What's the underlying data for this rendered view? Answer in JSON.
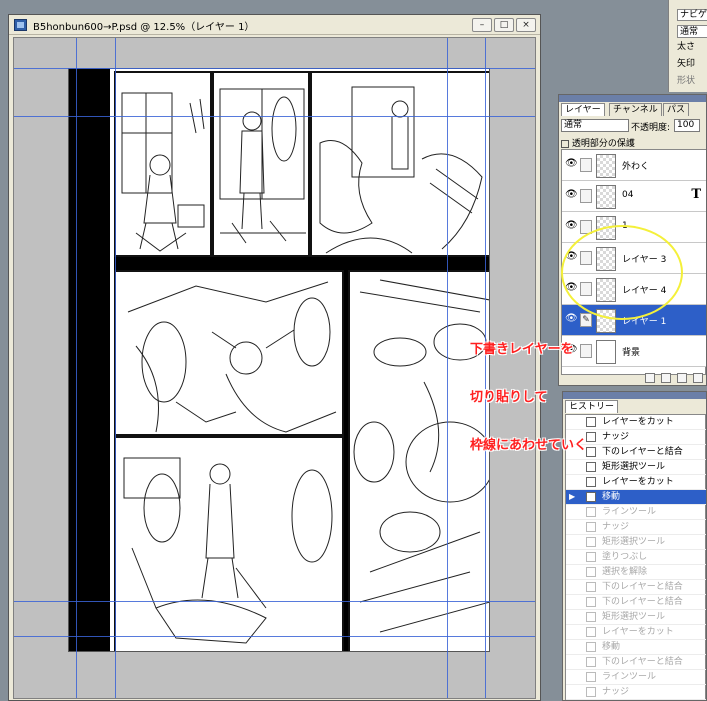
{
  "document": {
    "title": "B5honbun600→P.psd @ 12.5%（レイヤー 1）",
    "minimize": "–",
    "maximize": "□",
    "close": "×"
  },
  "annotation": {
    "lines": [
      "下書きレイヤーを",
      "切り貼りして",
      "枠線にあわせていく"
    ],
    "color": "#ff2020"
  },
  "toolpanel": {
    "tab": "ナビゲ",
    "mode": "通常",
    "thickness_label": "太さ",
    "arrow_label": "矢印",
    "shape_label": "形状"
  },
  "layers_palette": {
    "tabs": [
      "レイヤー",
      "チャンネル",
      "パス"
    ],
    "blend_mode": "通常",
    "opacity_label": "不透明度:",
    "opacity_value": "100",
    "lock_label": "透明部分の保護",
    "layers": [
      {
        "name": "外わく",
        "type": "normal",
        "selected": false
      },
      {
        "name": "04",
        "type": "text",
        "selected": false
      },
      {
        "name": "1",
        "type": "normal",
        "selected": false
      },
      {
        "name": "レイヤー 3",
        "type": "normal",
        "selected": false
      },
      {
        "name": "レイヤー 4",
        "type": "normal",
        "selected": false
      },
      {
        "name": "レイヤー 1",
        "type": "normal",
        "selected": true
      },
      {
        "name": "背景",
        "type": "background",
        "selected": false
      }
    ],
    "text_icon": "T"
  },
  "history_palette": {
    "tab": "ヒストリー",
    "items": [
      {
        "label": "レイヤーをカット",
        "state": "normal"
      },
      {
        "label": "ナッジ",
        "state": "normal"
      },
      {
        "label": "下のレイヤーと結合",
        "state": "normal"
      },
      {
        "label": "矩形選択ツール",
        "state": "normal"
      },
      {
        "label": "レイヤーをカット",
        "state": "normal"
      },
      {
        "label": "移動",
        "state": "active"
      },
      {
        "label": "ラインツール",
        "state": "dim"
      },
      {
        "label": "ナッジ",
        "state": "dim"
      },
      {
        "label": "矩形選択ツール",
        "state": "dim"
      },
      {
        "label": "塗りつぶし",
        "state": "dim"
      },
      {
        "label": "選択を解除",
        "state": "dim"
      },
      {
        "label": "下のレイヤーと結合",
        "state": "dim"
      },
      {
        "label": "下のレイヤーと結合",
        "state": "dim"
      },
      {
        "label": "矩形選択ツール",
        "state": "dim"
      },
      {
        "label": "レイヤーをカット",
        "state": "dim"
      },
      {
        "label": "移動",
        "state": "dim"
      },
      {
        "label": "下のレイヤーと結合",
        "state": "dim"
      },
      {
        "label": "ラインツール",
        "state": "dim"
      },
      {
        "label": "ナッジ",
        "state": "dim"
      }
    ]
  }
}
